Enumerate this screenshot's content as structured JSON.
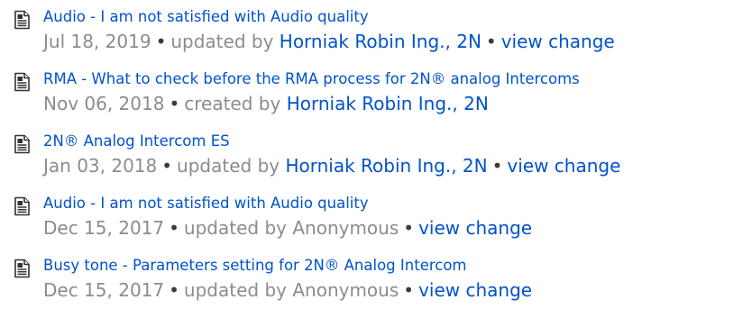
{
  "items": [
    {
      "icon": "page-icon",
      "title": "Audio - I am not satisfied with Audio quality",
      "date": "Jul 18, 2019",
      "action": "updated by",
      "author": "Horniak Robin Ing., 2N",
      "author_linked": true,
      "view_change": "view change"
    },
    {
      "icon": "page-icon",
      "title": "RMA - What to check before the RMA process for 2N® analog Intercoms",
      "date": "Nov 06, 2018",
      "action": "created by",
      "author": "Horniak Robin Ing., 2N",
      "author_linked": true,
      "view_change": ""
    },
    {
      "icon": "page-icon",
      "title": "2N® Analog Intercom ES",
      "date": "Jan 03, 2018",
      "action": "updated by",
      "author": "Horniak Robin Ing., 2N",
      "author_linked": true,
      "view_change": "view change"
    },
    {
      "icon": "page-icon",
      "title": "Audio - I am not satisfied with Audio quality",
      "date": "Dec 15, 2017",
      "action": "updated by",
      "author": "Anonymous",
      "author_linked": false,
      "view_change": "view change"
    },
    {
      "icon": "page-icon",
      "title": "Busy tone - Parameters setting for 2N® Analog Intercom",
      "date": "Dec 15, 2017",
      "action": "updated by",
      "author": "Anonymous",
      "author_linked": false,
      "view_change": "view change"
    }
  ],
  "separator": "•",
  "colors": {
    "link": "#0052cc",
    "muted": "#8c8c8c"
  }
}
